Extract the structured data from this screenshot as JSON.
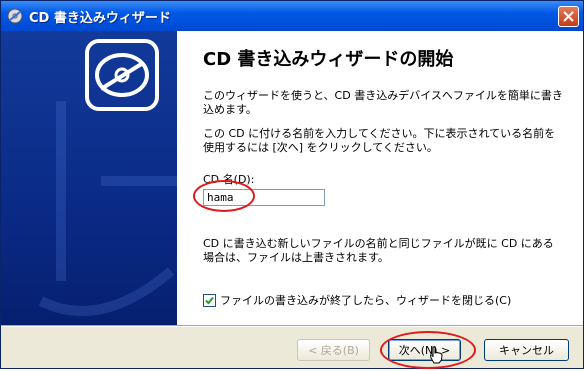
{
  "window": {
    "title": "CD 書き込みウィザード"
  },
  "heading": "CD 書き込みウィザードの開始",
  "paragraphs": [
    "このウィザードを使うと、CD 書き込みデバイスへファイルを簡単に書き込めます。",
    "この CD に付ける名前を入力してください。下に表示されている名前を使用するには [次へ] をクリックしてください。",
    "CD に書き込む新しいファイルの名前と同じファイルが既に CD にある場合は、ファイルは上書きされます。"
  ],
  "cd_name": {
    "label": "CD 名(D):",
    "value": "hama"
  },
  "close_after": {
    "label": "ファイルの書き込みが終了したら、ウィザードを閉じる(C)",
    "checked": true
  },
  "buttons": {
    "back": "< 戻る(B)",
    "next": "次へ(N) >",
    "cancel": "キャンセル"
  },
  "icons": {
    "window": "cd-writer-icon",
    "banner": "cd-disc-icon",
    "close": "close-icon",
    "cursor": "hand-pointer-icon"
  },
  "colors": {
    "banner": "#0a2a86",
    "annotation": "#e01a1a",
    "titlebar": "#0058e6"
  }
}
